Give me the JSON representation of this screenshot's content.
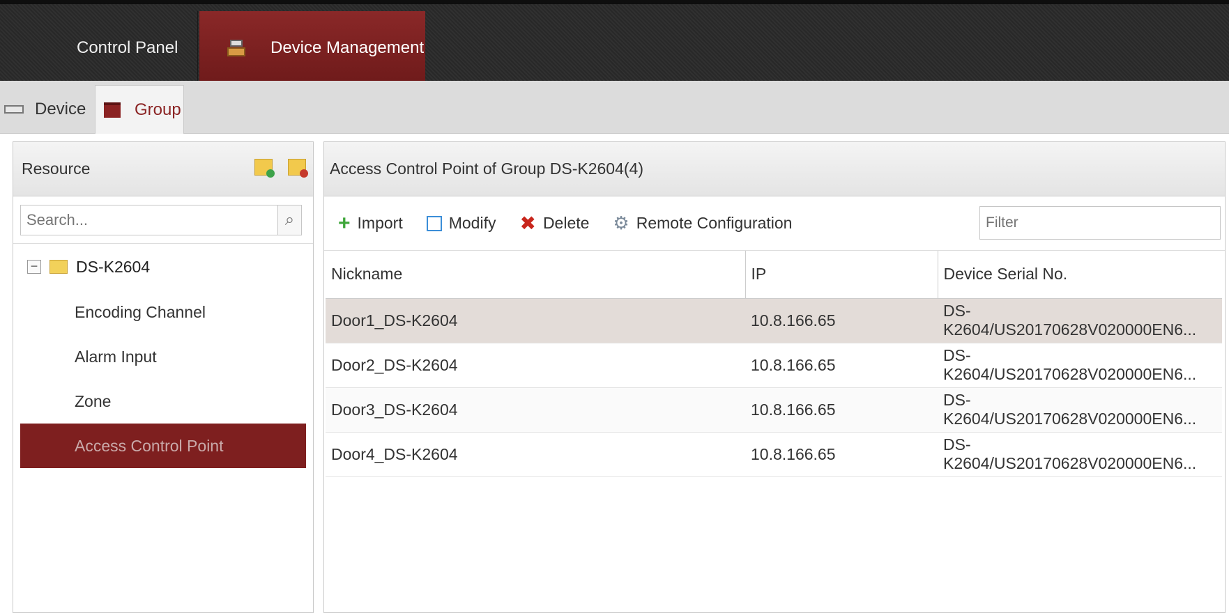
{
  "top_tabs": {
    "control_panel": "Control Panel",
    "device_management": "Device Management"
  },
  "sub_tabs": {
    "device": "Device",
    "group": "Group"
  },
  "resource_panel": {
    "title": "Resource",
    "search_placeholder": "Search...",
    "tree": {
      "root": "DS-K2604",
      "items": [
        "Encoding Channel",
        "Alarm Input",
        "Zone",
        "Access Control Point"
      ],
      "selected": "Access Control Point"
    }
  },
  "main_panel": {
    "title": "Access Control Point of Group DS-K2604(4)",
    "toolbar": {
      "import": "Import",
      "modify": "Modify",
      "delete": "Delete",
      "remote_configuration": "Remote Configuration"
    },
    "filter_placeholder": "Filter",
    "table": {
      "headers": [
        "Nickname",
        "IP",
        "Device Serial No."
      ],
      "rows": [
        [
          "Door1_DS-K2604",
          "10.8.166.65",
          "DS-K2604/US20170628V020000EN6..."
        ],
        [
          "Door2_DS-K2604",
          "10.8.166.65",
          "DS-K2604/US20170628V020000EN6..."
        ],
        [
          "Door3_DS-K2604",
          "10.8.166.65",
          "DS-K2604/US20170628V020000EN6..."
        ],
        [
          "Door4_DS-K2604",
          "10.8.166.65",
          "DS-K2604/US20170628V020000EN6..."
        ]
      ]
    }
  },
  "colors": {
    "accent": "#7e1f1f",
    "topbar": "#2a2a2a",
    "selected_row": "#e3dcd8"
  },
  "icons": {
    "control_panel": "grid-icon",
    "device_management": "device-icon",
    "device": "device-icon",
    "group": "folder-icon",
    "add_group": "add-folder-icon",
    "delete_group": "delete-folder-icon",
    "search": "search-icon",
    "import": "plus-icon",
    "modify": "edit-icon",
    "delete": "x-icon",
    "remote_configuration": "gear-icon"
  }
}
